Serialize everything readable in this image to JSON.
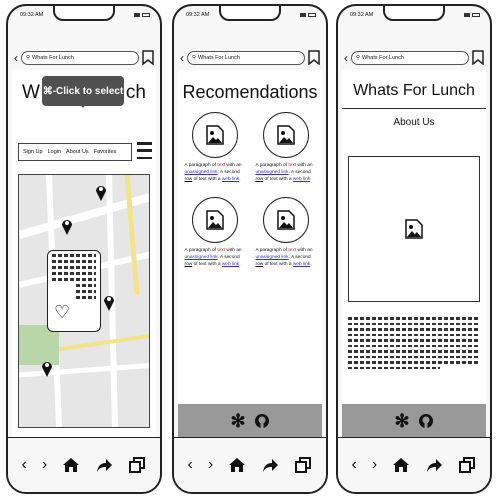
{
  "status": {
    "time": "09:32 AM"
  },
  "url": {
    "text": "Whats For Lunch"
  },
  "screen1": {
    "title_start": "W",
    "title_end": "ch",
    "tooltip": "⌘-Click to select",
    "menu": [
      "Sign Up",
      "Login",
      "About Us",
      "Favorites"
    ]
  },
  "screen2": {
    "title": "Recomendations",
    "card": {
      "t1": "A paragraph of ",
      "t2": "text",
      "t3": " with an ",
      "t4": "unassigned link",
      "t5": ". A second ",
      "t6": "row",
      "t7": " of text with a ",
      "t8": "web link",
      "t9": "."
    }
  },
  "screen3": {
    "title": "Whats For Lunch",
    "subtitle": "About Us"
  },
  "nav_icons": [
    "chevron-left-icon",
    "chevron-right-icon",
    "home-icon",
    "share-arrow-icon",
    "copy-icon"
  ],
  "footer_icons": [
    "yelp-icon",
    "github-icon"
  ]
}
